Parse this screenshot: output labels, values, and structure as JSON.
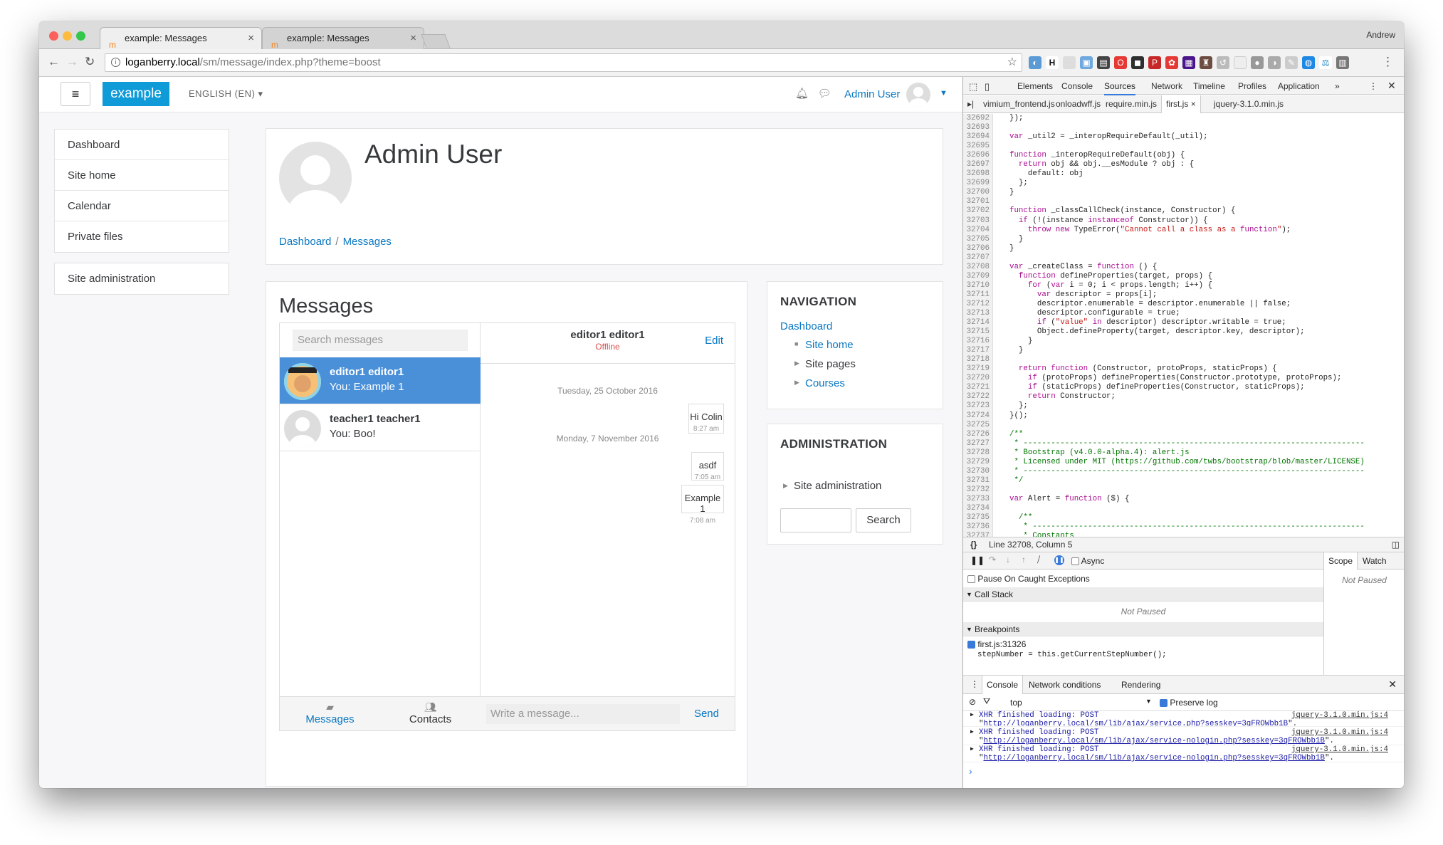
{
  "browser": {
    "tabs": [
      {
        "title": "example: Messages"
      },
      {
        "title": "example: Messages"
      }
    ],
    "user": "Andrew",
    "url_host": "loganberry.local",
    "url_path": "/sm/message/index.php?theme=boost"
  },
  "moodle": {
    "brand": "example",
    "language": "ENGLISH (EN)",
    "user_name": "Admin User",
    "left_nav": [
      "Dashboard",
      "Site home",
      "Calendar",
      "Private files"
    ],
    "site_admin": "Site administration",
    "page_title": "Admin User",
    "breadcrumbs": [
      "Dashboard",
      "Messages"
    ],
    "messages_title": "Messages",
    "search_placeholder": "Search messages",
    "contacts": [
      {
        "name": "editor1 editor1",
        "last": "You: Example 1"
      },
      {
        "name": "teacher1 teacher1",
        "last": "You: Boo!"
      }
    ],
    "chat": {
      "name": "editor1 editor1",
      "status": "Offline",
      "edit": "Edit",
      "days": [
        "Tuesday, 25 October 2016",
        "Monday, 7 November 2016"
      ],
      "messages": [
        {
          "text": "Hi Colin",
          "time": "8:27 am"
        },
        {
          "text": "asdf",
          "time": "7:05 am"
        },
        {
          "text": "Example 1",
          "time": "7:08 am"
        }
      ],
      "write_placeholder": "Write a message...",
      "send": "Send"
    },
    "footer_tabs": [
      "Messages",
      "Contacts"
    ],
    "navigation": {
      "title": "NAVIGATION",
      "dashboard": "Dashboard",
      "site_home": "Site home",
      "site_pages": "Site pages",
      "courses": "Courses"
    },
    "administration": {
      "title": "ADMINISTRATION",
      "site_admin": "Site administration",
      "search_button": "Search"
    }
  },
  "devtools": {
    "tabs": [
      "Elements",
      "Console",
      "Sources",
      "Network",
      "Timeline",
      "Profiles",
      "Application"
    ],
    "active_tab": "Sources",
    "files": [
      "vimium_frontend.js",
      "onloadwff.js",
      "require.min.js",
      "first.js",
      "jquery-3.1.0.min.js"
    ],
    "active_file": "first.js",
    "status": "Line 32708, Column 5",
    "async_label": "Async",
    "pause_caught": "Pause On Caught Exceptions",
    "call_stack": "Call Stack",
    "not_paused": "Not Paused",
    "breakpoints": "Breakpoints",
    "breakpoint_file": "first.js:31326",
    "breakpoint_code": "stepNumber = this.getCurrentStepNumber();",
    "scope": "Scope",
    "watch": "Watch",
    "console_tabs": [
      "Console",
      "Network conditions",
      "Rendering"
    ],
    "context": "top",
    "preserve_log": "Preserve log",
    "logs": [
      {
        "msg": "XHR finished loading: POST",
        "url": "http://loganberry.local/sm/lib/ajax/service.php?sesskey=3qFROWbb1B",
        "src": "jquery-3.1.0.min.js:4"
      },
      {
        "msg": "XHR finished loading: POST",
        "url": "http://loganberry.local/sm/lib/ajax/service-nologin.php?sesskey=3qFROWbb1B",
        "src": "jquery-3.1.0.min.js:4"
      },
      {
        "msg": "XHR finished loading: POST",
        "url": "http://loganberry.local/sm/lib/ajax/service-nologin.php?sesskey=3qFROWbb1B",
        "src": "jquery-3.1.0.min.js:4"
      }
    ],
    "code_start": 32692,
    "code_lines": [
      "  });",
      "",
      "  var _util2 = _interopRequireDefault(_util);",
      "",
      "  function _interopRequireDefault(obj) {",
      "    return obj && obj.__esModule ? obj : {",
      "      default: obj",
      "    };",
      "  }",
      "",
      "  function _classCallCheck(instance, Constructor) {",
      "    if (!(instance instanceof Constructor)) {",
      "      throw new TypeError(\"Cannot call a class as a function\");",
      "    }",
      "  }",
      "",
      "  var _createClass = function () {",
      "    function defineProperties(target, props) {",
      "      for (var i = 0; i < props.length; i++) {",
      "        var descriptor = props[i];",
      "        descriptor.enumerable = descriptor.enumerable || false;",
      "        descriptor.configurable = true;",
      "        if (\"value\" in descriptor) descriptor.writable = true;",
      "        Object.defineProperty(target, descriptor.key, descriptor);",
      "      }",
      "    }",
      "",
      "    return function (Constructor, protoProps, staticProps) {",
      "      if (protoProps) defineProperties(Constructor.prototype, protoProps);",
      "      if (staticProps) defineProperties(Constructor, staticProps);",
      "      return Constructor;",
      "    };",
      "  }();",
      "",
      "  /**",
      "   * --------------------------------------------------------------------------",
      "   * Bootstrap (v4.0.0-alpha.4): alert.js",
      "   * Licensed under MIT (https://github.com/twbs/bootstrap/blob/master/LICENSE)",
      "   * --------------------------------------------------------------------------",
      "   */",
      "",
      "  var Alert = function ($) {",
      "",
      "    /**",
      "     * ------------------------------------------------------------------------",
      "     * Constants"
    ]
  }
}
